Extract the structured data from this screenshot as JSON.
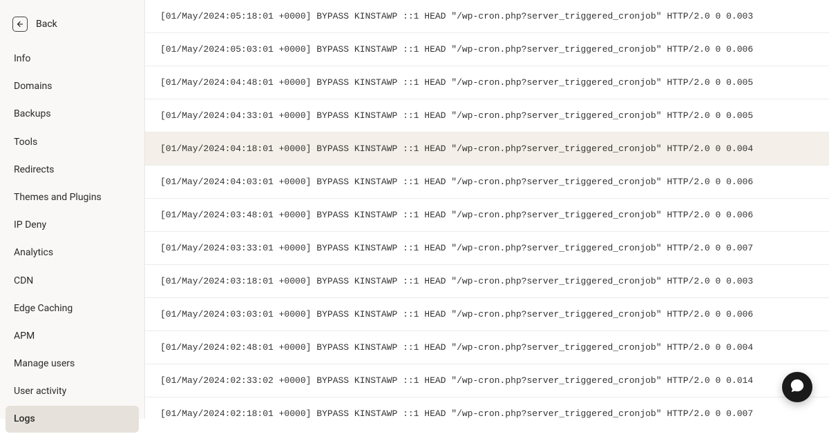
{
  "sidebar": {
    "back_label": "Back",
    "items": [
      {
        "label": "Info",
        "active": false
      },
      {
        "label": "Domains",
        "active": false
      },
      {
        "label": "Backups",
        "active": false
      },
      {
        "label": "Tools",
        "active": false
      },
      {
        "label": "Redirects",
        "active": false
      },
      {
        "label": "Themes and Plugins",
        "active": false
      },
      {
        "label": "IP Deny",
        "active": false
      },
      {
        "label": "Analytics",
        "active": false
      },
      {
        "label": "CDN",
        "active": false
      },
      {
        "label": "Edge Caching",
        "active": false
      },
      {
        "label": "APM",
        "active": false
      },
      {
        "label": "Manage users",
        "active": false
      },
      {
        "label": "User activity",
        "active": false
      },
      {
        "label": "Logs",
        "active": true
      }
    ]
  },
  "logs": {
    "highlighted_index": 4,
    "entries": [
      "[01/May/2024:05:18:01 +0000] BYPASS KINSTAWP ::1 HEAD \"/wp-cron.php?server_triggered_cronjob\" HTTP/2.0 0 0.003",
      "[01/May/2024:05:03:01 +0000] BYPASS KINSTAWP ::1 HEAD \"/wp-cron.php?server_triggered_cronjob\" HTTP/2.0 0 0.006",
      "[01/May/2024:04:48:01 +0000] BYPASS KINSTAWP ::1 HEAD \"/wp-cron.php?server_triggered_cronjob\" HTTP/2.0 0 0.005",
      "[01/May/2024:04:33:01 +0000] BYPASS KINSTAWP ::1 HEAD \"/wp-cron.php?server_triggered_cronjob\" HTTP/2.0 0 0.005",
      "[01/May/2024:04:18:01 +0000] BYPASS KINSTAWP ::1 HEAD \"/wp-cron.php?server_triggered_cronjob\" HTTP/2.0 0 0.004",
      "[01/May/2024:04:03:01 +0000] BYPASS KINSTAWP ::1 HEAD \"/wp-cron.php?server_triggered_cronjob\" HTTP/2.0 0 0.006",
      "[01/May/2024:03:48:01 +0000] BYPASS KINSTAWP ::1 HEAD \"/wp-cron.php?server_triggered_cronjob\" HTTP/2.0 0 0.006",
      "[01/May/2024:03:33:01 +0000] BYPASS KINSTAWP ::1 HEAD \"/wp-cron.php?server_triggered_cronjob\" HTTP/2.0 0 0.007",
      "[01/May/2024:03:18:01 +0000] BYPASS KINSTAWP ::1 HEAD \"/wp-cron.php?server_triggered_cronjob\" HTTP/2.0 0 0.003",
      "[01/May/2024:03:03:01 +0000] BYPASS KINSTAWP ::1 HEAD \"/wp-cron.php?server_triggered_cronjob\" HTTP/2.0 0 0.006",
      "[01/May/2024:02:48:01 +0000] BYPASS KINSTAWP ::1 HEAD \"/wp-cron.php?server_triggered_cronjob\" HTTP/2.0 0 0.004",
      "[01/May/2024:02:33:02 +0000] BYPASS KINSTAWP ::1 HEAD \"/wp-cron.php?server_triggered_cronjob\" HTTP/2.0 0 0.014",
      "[01/May/2024:02:18:01 +0000] BYPASS KINSTAWP ::1 HEAD \"/wp-cron.php?server_triggered_cronjob\" HTTP/2.0 0 0.007"
    ]
  }
}
